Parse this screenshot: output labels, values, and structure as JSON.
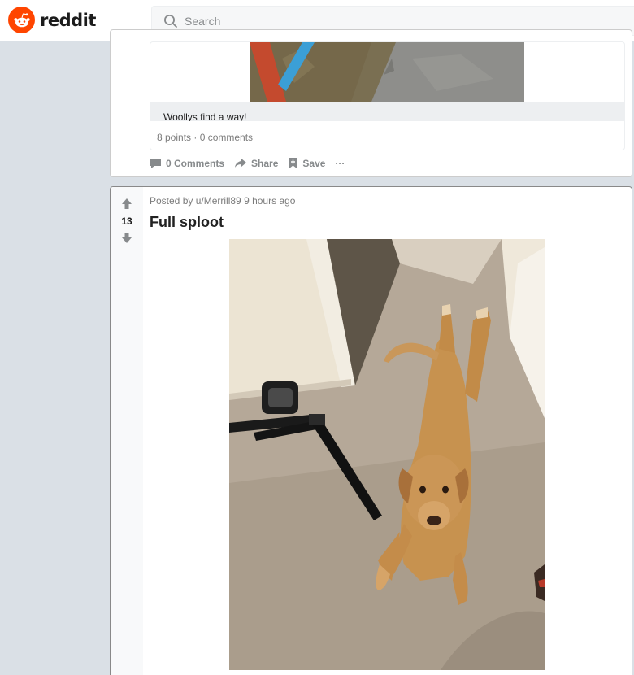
{
  "header": {
    "logo_text": "reddit",
    "search_placeholder": "Search"
  },
  "previous_post": {
    "crosspost_title": "Woollys find a way!",
    "crosspost_meta": "8 points · 0 comments",
    "actions": {
      "comments": "0 Comments",
      "share": "Share",
      "save": "Save",
      "more": "···"
    }
  },
  "post": {
    "vote_count": "13",
    "posted_by_prefix": "Posted by",
    "author": "u/Merrill89",
    "time": "9 hours ago",
    "title": "Full sploot"
  },
  "colors": {
    "brand": "#ff4500",
    "icon_gray": "#878a8c"
  }
}
